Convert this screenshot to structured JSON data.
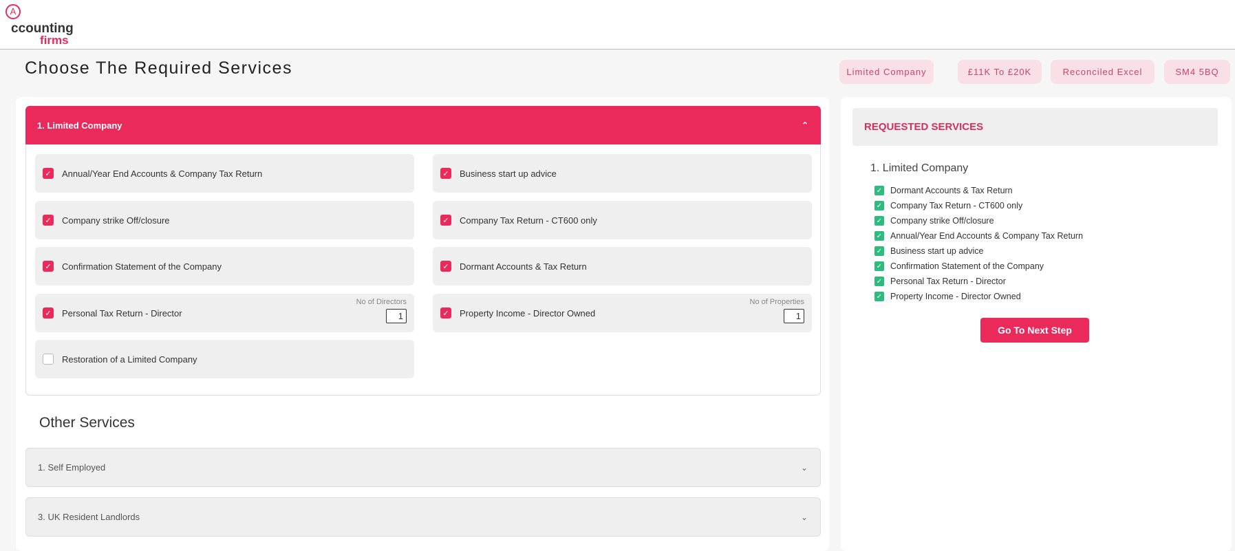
{
  "logo": {
    "text_top": "ccounting",
    "text_bottom": "firms",
    "mark": "A"
  },
  "page_title": "Choose The Required Services",
  "tags": [
    "Limited Company",
    "£11K To £20K",
    "Reconciled Excel",
    "SM4 5BQ"
  ],
  "main_accordion": {
    "title": "1. Limited Company",
    "items": [
      {
        "label": "Annual/Year End Accounts & Company Tax Return",
        "checked": true
      },
      {
        "label": "Business start up advice",
        "checked": true
      },
      {
        "label": "Company strike Off/closure",
        "checked": true
      },
      {
        "label": "Company Tax Return - CT600 only",
        "checked": true
      },
      {
        "label": "Confirmation Statement of the Company",
        "checked": true
      },
      {
        "label": "Dormant Accounts & Tax Return",
        "checked": true
      },
      {
        "label": "Personal Tax Return - Director",
        "checked": true,
        "count_label": "No of Directors",
        "count": "1"
      },
      {
        "label": "Property Income - Director Owned",
        "checked": true,
        "count_label": "No of Properties",
        "count": "1"
      },
      {
        "label": "Restoration of a Limited Company",
        "checked": false
      }
    ]
  },
  "other_services": {
    "title": "Other Services",
    "items": [
      "1. Self Employed",
      "3. UK Resident Landlords"
    ]
  },
  "requested": {
    "title": "REQUESTED SERVICES",
    "group": "1. Limited Company",
    "items": [
      "Dormant Accounts & Tax Return",
      "Company Tax Return - CT600 only",
      "Company strike Off/closure",
      "Annual/Year End Accounts & Company Tax Return",
      "Business start up advice",
      "Confirmation Statement of the Company",
      "Personal Tax Return - Director",
      "Property Income - Director Owned"
    ],
    "next_button": "Go To Next Step"
  },
  "colors": {
    "accent": "#eb2a5c",
    "check_green": "#2dbb7f"
  }
}
